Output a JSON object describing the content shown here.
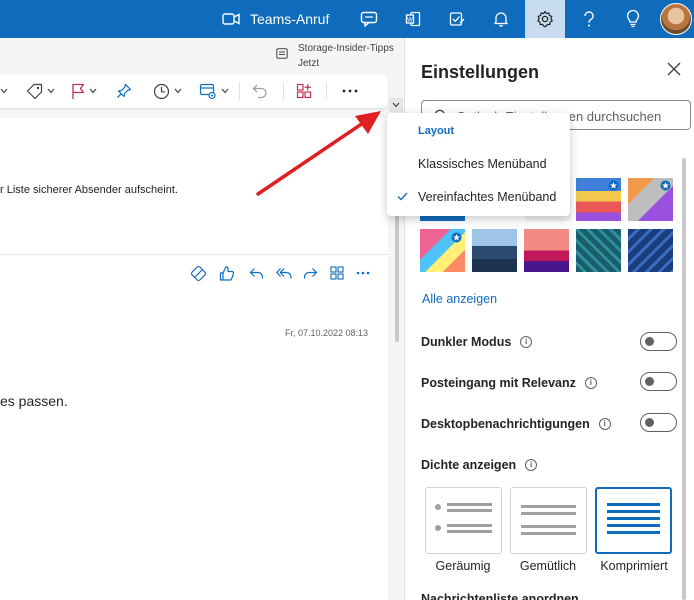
{
  "topbar": {
    "teams_call_label": "Teams-Anruf",
    "icons": [
      "video-camera-icon",
      "chat-icon",
      "office-icon",
      "todo-icon",
      "bell-icon",
      "gear-icon",
      "help-icon",
      "lightbulb-icon"
    ]
  },
  "notice": {
    "title": "Storage-Insider-Tipps",
    "time": "Jetzt"
  },
  "email": {
    "safe_sender_text": "r Liste sicherer Absender aufscheint.",
    "date": "Fr, 07.10.2022 08:13",
    "body_text": "es passen."
  },
  "layout_menu": {
    "header": "Layout",
    "items": [
      {
        "label": "Klassisches Menüband",
        "checked": false
      },
      {
        "label": "Vereinfachtes Menüband",
        "checked": true
      }
    ]
  },
  "settings": {
    "title": "Einstellungen",
    "search_placeholder": "Outlook-Einstellungen durchsuchen",
    "show_all": "Alle anzeigen",
    "toggles": [
      {
        "label": "Dunkler Modus",
        "on": false
      },
      {
        "label": "Posteingang mit Relevanz",
        "on": false
      },
      {
        "label": "Desktopbenachrichtigungen",
        "on": false
      }
    ],
    "density_heading": "Dichte anzeigen",
    "density_options": [
      {
        "label": "Geräumig",
        "selected": false
      },
      {
        "label": "Gemütlich",
        "selected": false
      },
      {
        "label": "Komprimiert",
        "selected": true
      }
    ],
    "next_heading": "Nachrichtenliste anordnen"
  },
  "colors": {
    "brand": "#0f6cbd",
    "annotation_arrow": "#e02020"
  }
}
